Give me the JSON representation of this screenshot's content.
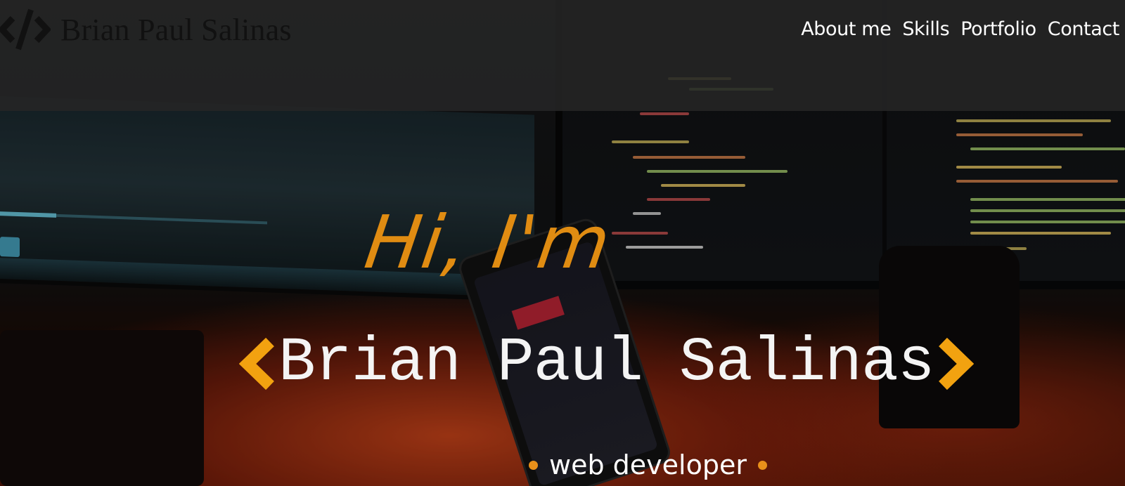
{
  "header": {
    "brand_name": "Brian Paul Salinas",
    "logo_icon": "code-brackets-icon"
  },
  "nav": {
    "items": [
      {
        "label": "About me"
      },
      {
        "label": "Skills"
      },
      {
        "label": "Portfolio"
      },
      {
        "label": "Contact"
      }
    ]
  },
  "hero": {
    "greeting": "Hi, I'm",
    "name": "Brian Paul Salinas",
    "left_glyph": "chevron-left-icon",
    "right_glyph": "chevron-right-icon",
    "role": "web developer"
  },
  "colors": {
    "accent": "#f2a210",
    "greeting": "#e08c12",
    "header_bg": "#262626"
  }
}
